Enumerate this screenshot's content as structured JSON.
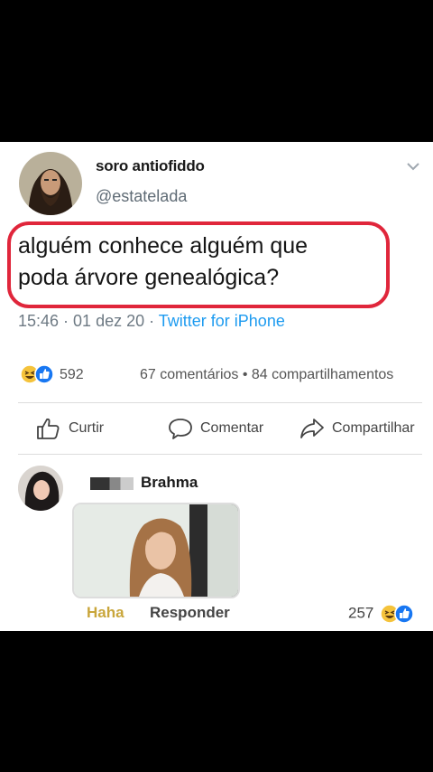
{
  "tweet": {
    "author": "soro antiofiddo",
    "handle": "@estatelada",
    "text_line1": "alguém conhece alguém que",
    "text_line2": "poda árvore genealógica?",
    "timestamp": "15:46 · 01 dez 20 · ",
    "source": "Twitter for iPhone"
  },
  "post": {
    "reaction_count": "592",
    "comments": "67 comentários",
    "stats_separator": " • ",
    "shares": "84 compartilhamentos"
  },
  "actions": {
    "like": "Curtir",
    "comment": "Comentar",
    "share": "Compartilhar"
  },
  "comment": {
    "name": "Brahma",
    "reaction_label": "Haha",
    "reply_label": "Responder",
    "reaction_count": "257"
  },
  "icons": {
    "reaction_icons": [
      "haha-emoji-icon",
      "like-thumb-icon"
    ],
    "menu": "chevron-down-icon"
  },
  "colors": {
    "highlight": "#e0263b",
    "link": "#1d9bf0",
    "haha": "#c9a63b",
    "like_blue": "#1877f2"
  }
}
